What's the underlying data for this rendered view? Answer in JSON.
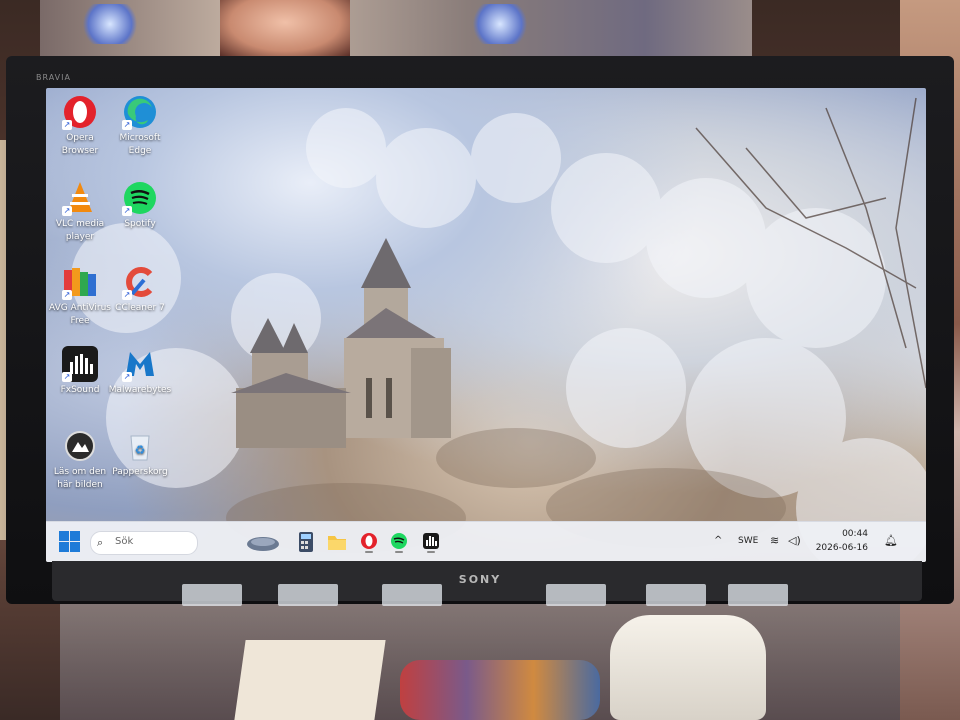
{
  "desktop": {
    "icons": [
      {
        "label": "Opera Browser",
        "icon": "opera-icon"
      },
      {
        "label": "Microsoft Edge",
        "icon": "edge-icon"
      },
      {
        "label": "VLC media player",
        "icon": "vlc-icon"
      },
      {
        "label": "Spotify",
        "icon": "spotify-icon"
      },
      {
        "label": "AVG AntiVirus Free",
        "icon": "avg-icon"
      },
      {
        "label": "CCleaner 7",
        "icon": "ccleaner-icon"
      },
      {
        "label": "FxSound",
        "icon": "fxsound-icon"
      },
      {
        "label": "Malwarebytes",
        "icon": "malwarebytes-icon"
      },
      {
        "label": "Läs om den här bilden",
        "icon": "learn-about-picture-icon"
      },
      {
        "label": "Papperskorg",
        "icon": "recycle-bin-icon"
      }
    ]
  },
  "monitor": {
    "brand_top": "BRAVIA",
    "brand_bottom": "SONY"
  },
  "taskbar": {
    "search_placeholder": "Sök",
    "pinned": [
      "widgets-icon",
      "calculator-icon",
      "file-explorer-icon",
      "opera-icon",
      "spotify-icon",
      "fxsound-icon"
    ],
    "tray": {
      "language": "SWE",
      "time": "00:44",
      "date": "2026-06-16"
    }
  },
  "colors": {
    "opera": "#e3222b",
    "edge": "#1f8fd6",
    "vlc": "#f28a0f",
    "spotify": "#1ed760",
    "accent": "#1e7bd8"
  }
}
